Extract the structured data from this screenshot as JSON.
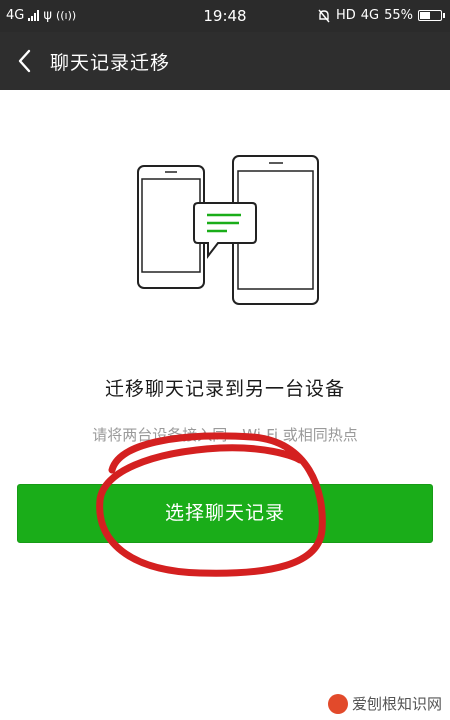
{
  "status_bar": {
    "network": "4G",
    "usb": "ψ",
    "hotspot": "((ı))",
    "time": "19:48",
    "hd": "HD",
    "network2": "4G",
    "battery_text": "55%",
    "battery_level": 0.55,
    "icons": [
      "signal-icon",
      "usb-icon",
      "hotspot-icon",
      "mute-icon",
      "battery-icon"
    ]
  },
  "nav": {
    "back_icon": "chevron-left-icon",
    "title": "聊天记录迁移"
  },
  "content": {
    "illustration": "phone-tablet-transfer-illustration",
    "title": "迁移聊天记录到另一台设备",
    "subtitle": "请将两台设备接入同一Wi-Fi 或相同热点"
  },
  "action": {
    "select_label": "选择聊天记录"
  },
  "watermark": {
    "text": "爱刨根知识网"
  },
  "colors": {
    "accent": "#1aad19",
    "navbar": "#2e2e2e",
    "annotation": "#d42020"
  }
}
